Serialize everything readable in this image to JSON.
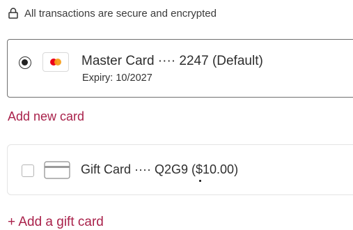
{
  "security": {
    "icon": "lock-icon",
    "text": "All transactions are secure and encrypted"
  },
  "saved_card": {
    "selected": true,
    "brand_icon": "mastercard-icon",
    "title": "Master Card ···· 2247 (Default)",
    "expiry": "Expiry: 10/2027"
  },
  "add_card_label": "Add new card",
  "gift_card": {
    "checked": false,
    "icon": "card-icon",
    "title": "Gift Card ···· Q2G9 ($10.00)"
  },
  "add_gift_label": "+ Add a gift card",
  "colors": {
    "link": "#a9224b",
    "mastercard_red": "#eb001b",
    "mastercard_orange": "#f79e1b"
  }
}
